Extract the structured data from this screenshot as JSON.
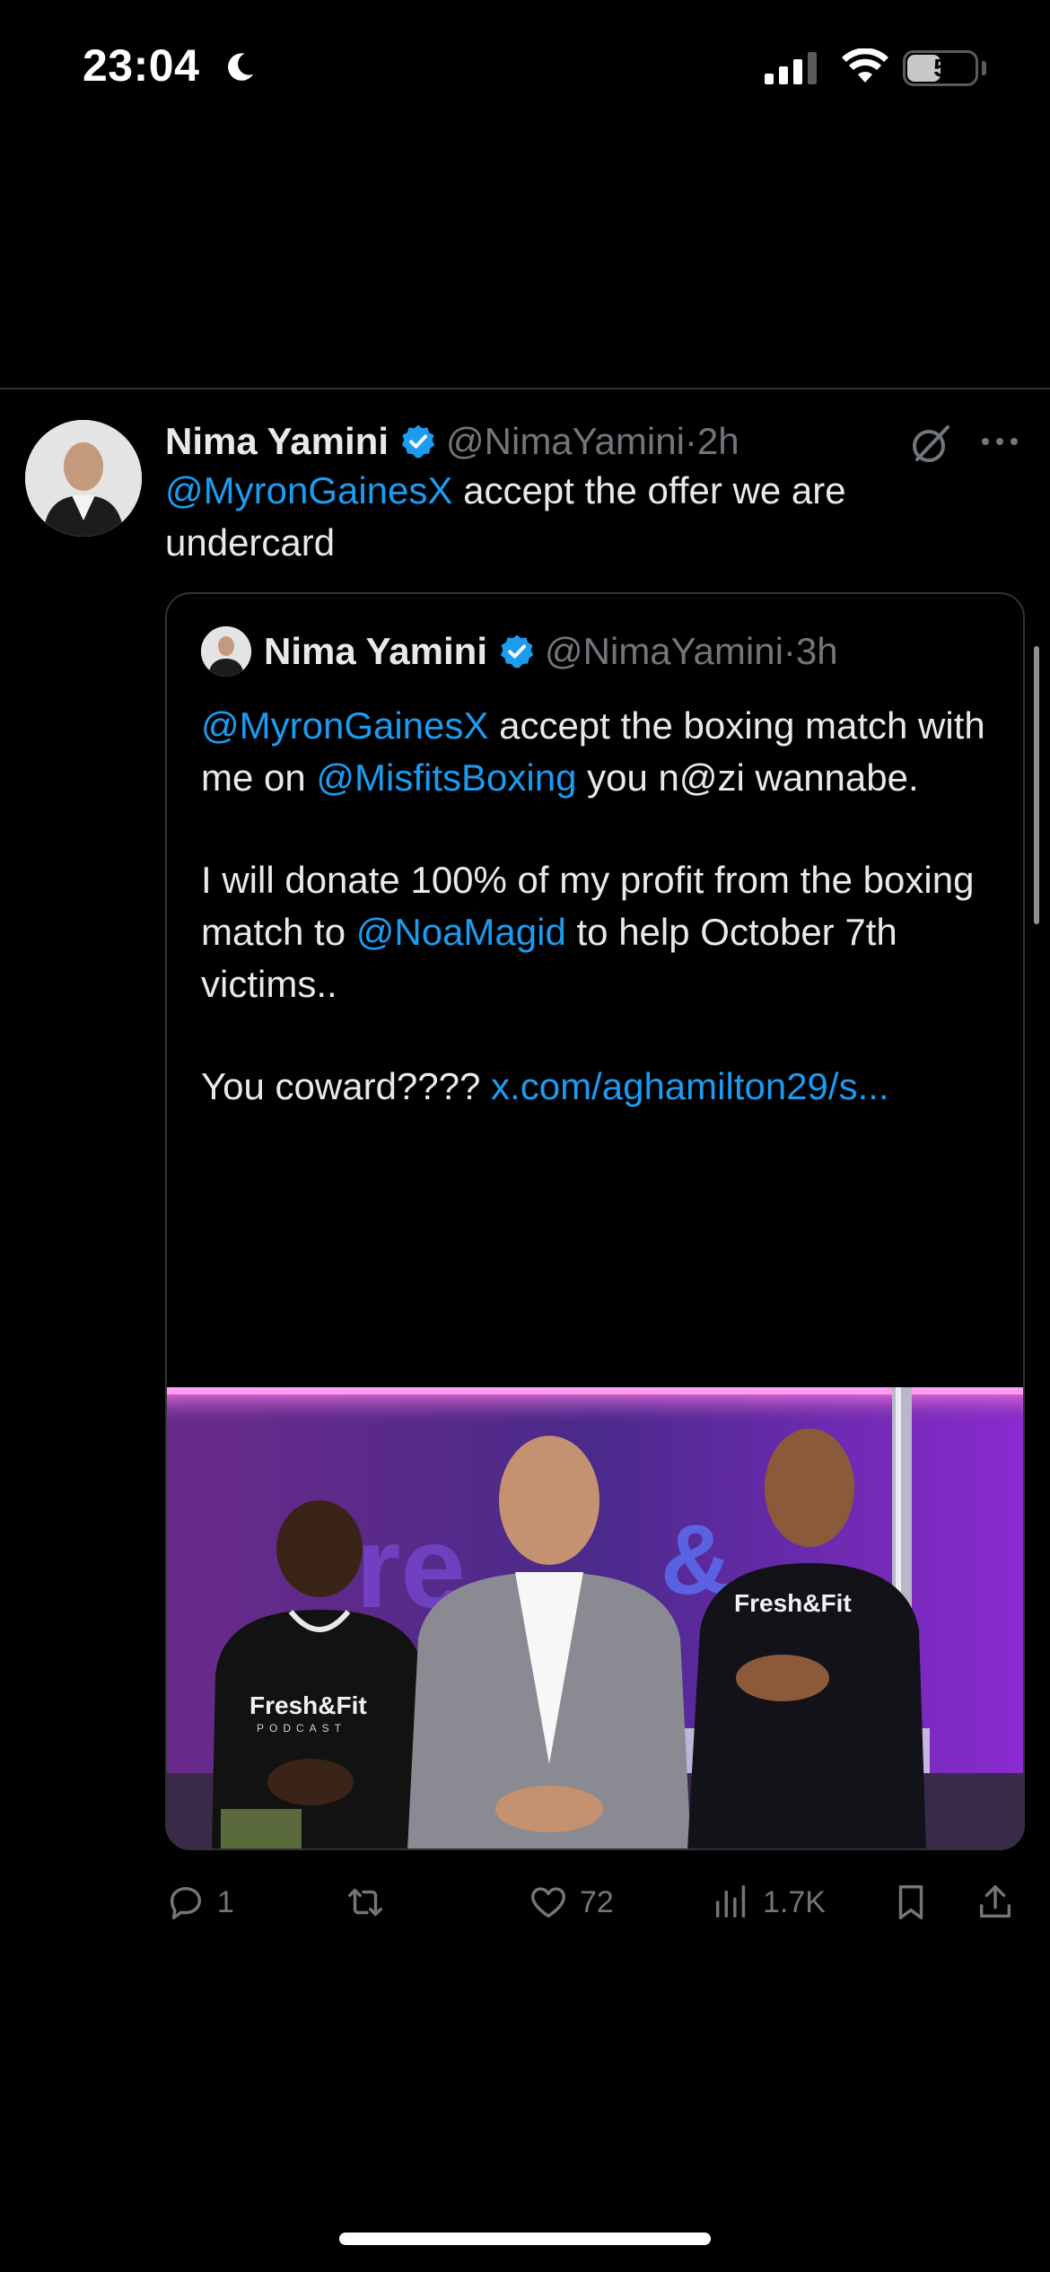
{
  "status_bar": {
    "time": "23:04",
    "battery_level": "5",
    "icons": [
      "moon-icon",
      "cellular-signal-icon",
      "wifi-icon",
      "battery-icon"
    ]
  },
  "tweet": {
    "author_name": "Nima Yamini",
    "handle": "@NimaYamini",
    "separator": "·",
    "timestamp": "2h",
    "text_mention": "@MyronGainesX",
    "text_rest": " accept the offer we are undercard",
    "quoted": {
      "author_name": "Nima Yamini",
      "handle": "@NimaYamini",
      "separator": "·",
      "timestamp": "3h",
      "p1_mention1": "@MyronGainesX",
      "p1_text1": " accept the boxing match with me on ",
      "p1_mention2": "@MisfitsBoxing",
      "p1_text2": " you n@zi wannabe.",
      "p2_text1": "I will donate 100% of my profit from the boxing match to ",
      "p2_mention": "@NoaMagid",
      "p2_text2": " to help October 7th victims..",
      "p3_text": "You coward???? ",
      "p3_link": "x.com/aghamilton29/s...",
      "image_text_left": "Fresh&Fit",
      "image_text_sub": "PODCAST",
      "image_text_right": "Fresh&Fit"
    },
    "actions": {
      "replies": "1",
      "reposts": "",
      "likes": "72",
      "views": "1.7K"
    }
  },
  "colors": {
    "background": "#000000",
    "text": "#e7e9ea",
    "secondary": "#71767b",
    "link": "#1d9bf0",
    "border": "#2f3336"
  }
}
